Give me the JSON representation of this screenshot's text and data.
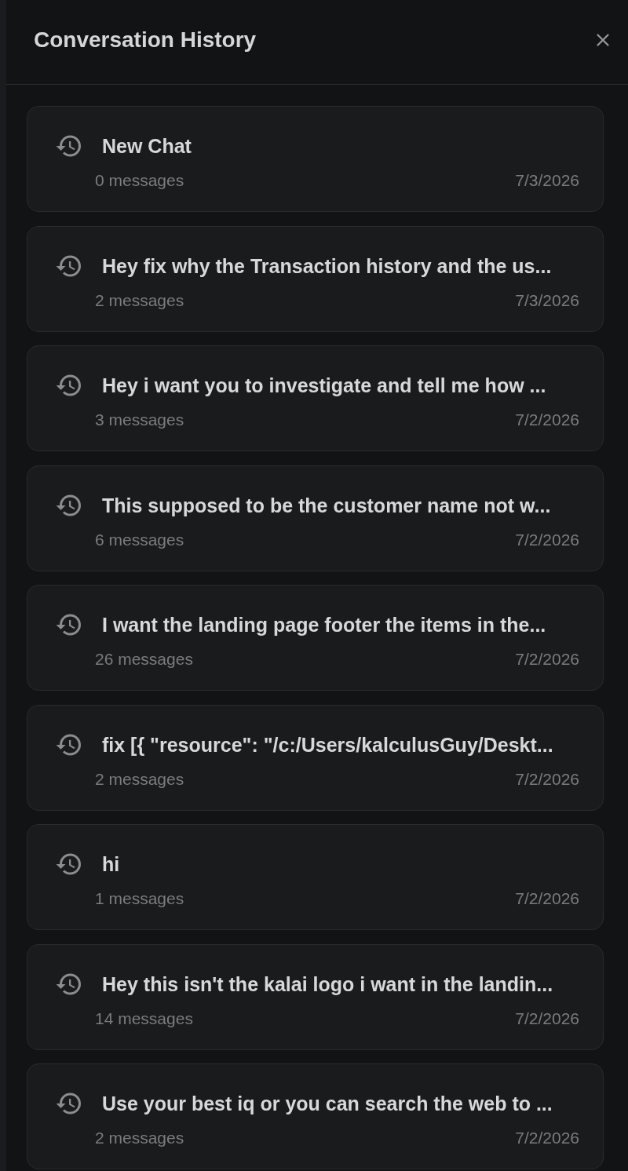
{
  "panel": {
    "title": "Conversation History"
  },
  "conversations": [
    {
      "title": "New Chat",
      "messages": "0 messages",
      "date": "7/3/2026"
    },
    {
      "title": "Hey fix why the Transaction history and the us...",
      "messages": "2 messages",
      "date": "7/3/2026"
    },
    {
      "title": "Hey i want you to investigate and tell me how ...",
      "messages": "3 messages",
      "date": "7/2/2026"
    },
    {
      "title": "This supposed to be the customer name not w...",
      "messages": "6 messages",
      "date": "7/2/2026"
    },
    {
      "title": "I want the landing page footer the items in the...",
      "messages": "26 messages",
      "date": "7/2/2026"
    },
    {
      "title": "fix [{ \"resource\": \"/c:/Users/kalculusGuy/Deskt...",
      "messages": "2 messages",
      "date": "7/2/2026"
    },
    {
      "title": "hi",
      "messages": "1 messages",
      "date": "7/2/2026"
    },
    {
      "title": "Hey this isn't the kalai logo i want in the landin...",
      "messages": "14 messages",
      "date": "7/2/2026"
    },
    {
      "title": "Use your best iq or you can search the web to ...",
      "messages": "2 messages",
      "date": "7/2/2026"
    }
  ]
}
